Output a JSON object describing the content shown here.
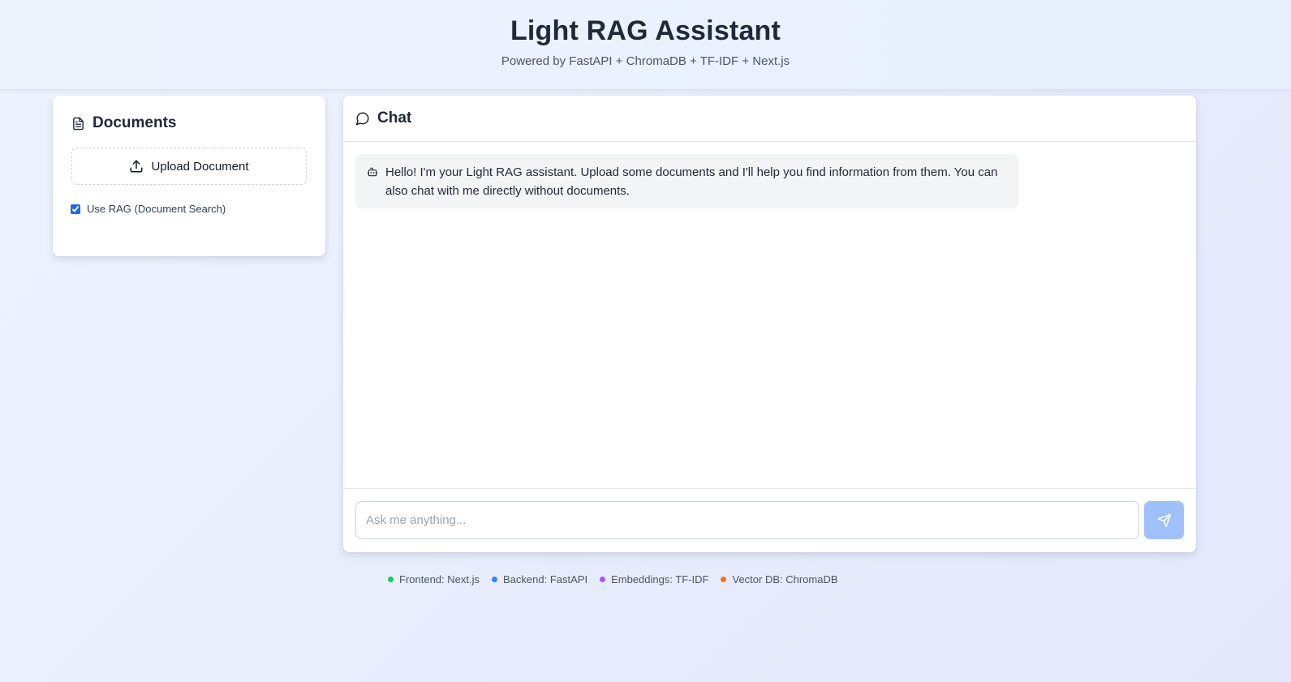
{
  "header": {
    "title": "Light RAG Assistant",
    "subtitle": "Powered by FastAPI + ChromaDB + TF-IDF + Next.js"
  },
  "documents": {
    "title": "Documents",
    "icon": "file-text-icon",
    "upload_label": "Upload Document",
    "upload_icon": "upload-icon",
    "rag_label": "Use RAG (Document Search)",
    "rag_checked": true
  },
  "chat": {
    "title": "Chat",
    "icon": "message-circle-icon",
    "messages": [
      {
        "role": "assistant",
        "icon": "bot-icon",
        "text": "Hello! I'm your Light RAG assistant. Upload some documents and I'll help you find information from them. You can also chat with me directly without documents."
      }
    ],
    "input_value": "",
    "input_placeholder": "Ask me anything...",
    "send_icon": "send-icon"
  },
  "stack": [
    {
      "label": "Frontend: Next.js",
      "color": "#22c55e"
    },
    {
      "label": "Backend: FastAPI",
      "color": "#3b82f6"
    },
    {
      "label": "Embeddings: TF-IDF",
      "color": "#a855f7"
    },
    {
      "label": "Vector DB: ChromaDB",
      "color": "#f97316"
    }
  ],
  "colors": {
    "send_button": "#9fc0fb",
    "bubble_bg": "#f3f4f6",
    "accent": "#2563eb"
  }
}
